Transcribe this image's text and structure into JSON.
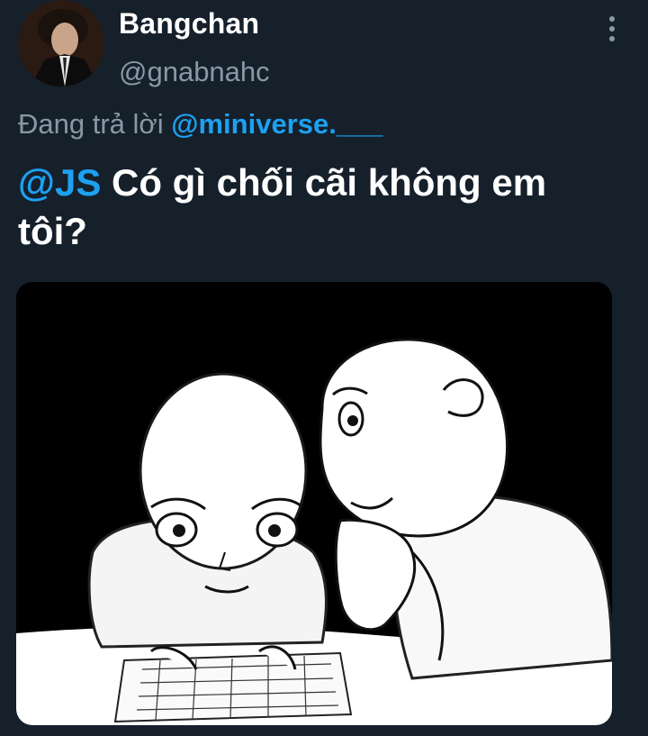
{
  "user": {
    "display_name": "Bangchan",
    "handle": "@gnabnahc"
  },
  "reply": {
    "prefix": "Đang trả lời",
    "to": "@miniverse.___"
  },
  "tweet": {
    "mention": "@JS",
    "text": "Có gì chối cãi không em tôi?"
  },
  "colors": {
    "background": "#15202b",
    "accent": "#1da1f2",
    "secondary_text": "#8899a6"
  },
  "icons": {
    "more": "more-vertical-icon"
  }
}
